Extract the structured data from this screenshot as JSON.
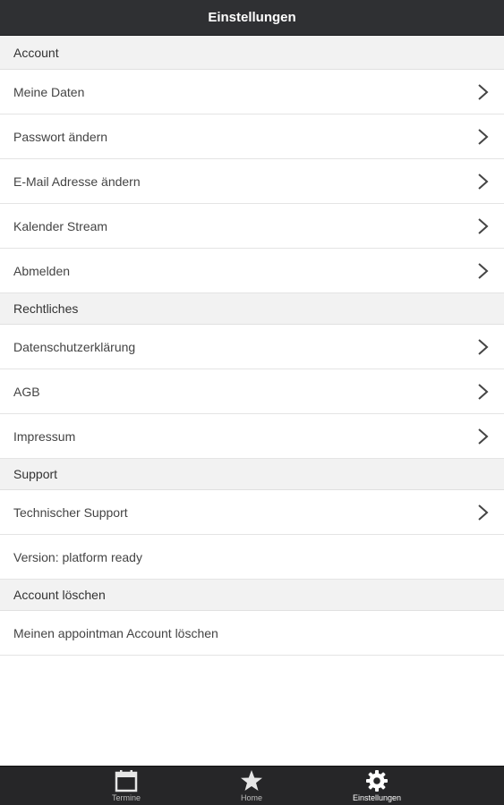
{
  "header": {
    "title": "Einstellungen"
  },
  "sections": {
    "account": {
      "title": "Account",
      "items": [
        {
          "label": "Meine Daten"
        },
        {
          "label": "Passwort ändern"
        },
        {
          "label": "E-Mail Adresse ändern"
        },
        {
          "label": "Kalender Stream"
        },
        {
          "label": "Abmelden"
        }
      ]
    },
    "legal": {
      "title": "Rechtliches",
      "items": [
        {
          "label": "Datenschutzerklärung"
        },
        {
          "label": "AGB"
        },
        {
          "label": "Impressum"
        }
      ]
    },
    "support": {
      "title": "Support",
      "items": [
        {
          "label": "Technischer Support"
        }
      ],
      "version": "Version: platform ready"
    },
    "delete": {
      "title": "Account löschen",
      "action": "Meinen appointman Account löschen"
    }
  },
  "tabbar": {
    "tabs": [
      {
        "label": "Termine",
        "icon": "calendar-icon"
      },
      {
        "label": "Home",
        "icon": "star-icon"
      },
      {
        "label": "Einstellungen",
        "icon": "gear-icon",
        "active": true
      }
    ]
  },
  "colors": {
    "header_bg": "#2f3033",
    "section_bg": "#f2f2f2",
    "tabbar_bg": "#262628"
  }
}
